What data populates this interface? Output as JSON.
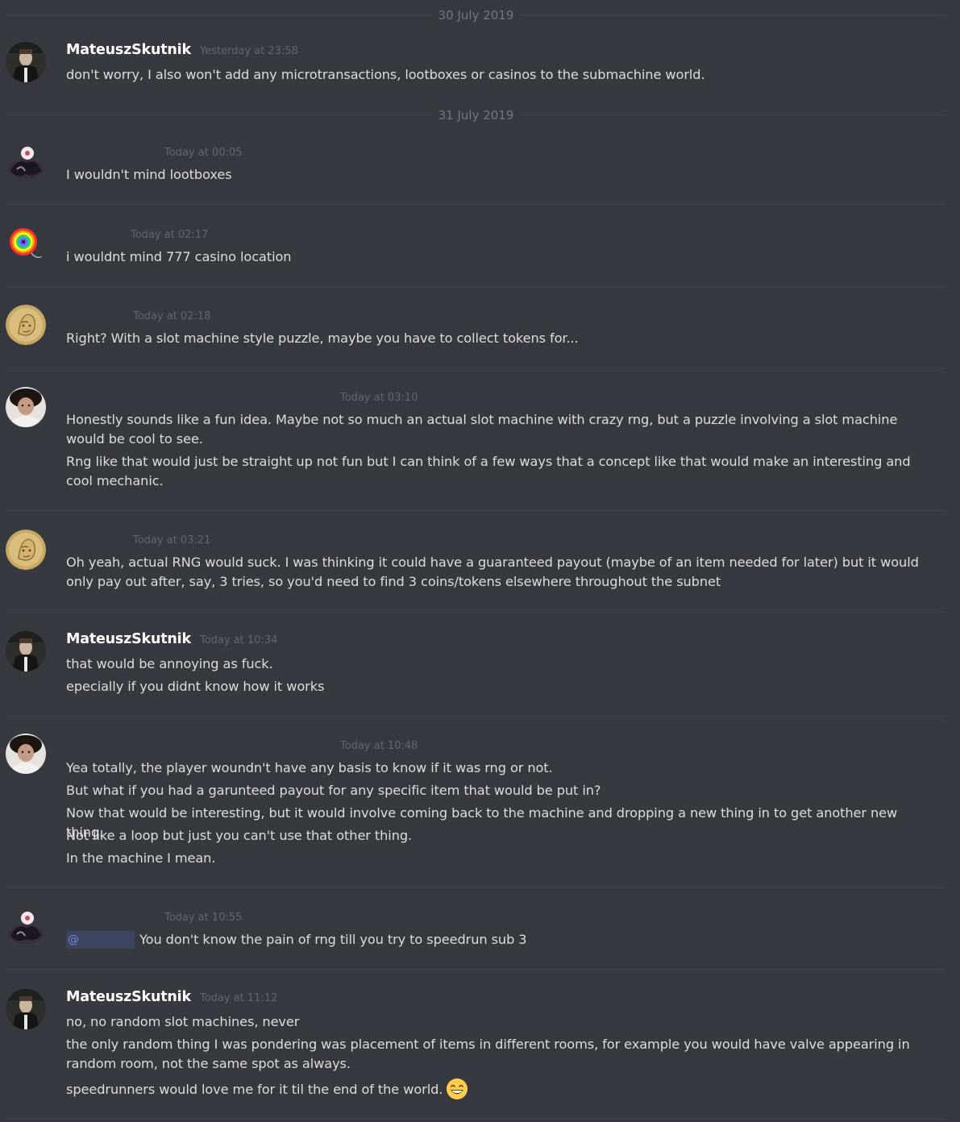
{
  "dividers": [
    "30 July 2019",
    "31 July 2019"
  ],
  "messages": [
    {
      "username": "MateuszSkutnik",
      "timestamp": "Yesterday at 23:58",
      "lines": [
        "don't worry, I also won't add any microtransactions, lootboxes or casinos to the submachine world."
      ]
    },
    {
      "username": "",
      "timestamp": "Today at 00:05",
      "lines": [
        "I wouldn't mind lootboxes"
      ]
    },
    {
      "username": "",
      "timestamp": "Today at 02:17",
      "lines": [
        "i wouldnt mind 777 casino location"
      ]
    },
    {
      "username": "",
      "timestamp": "Today at 02:18",
      "lines": [
        "Right? With a slot machine style puzzle, maybe you have to collect tokens for..."
      ]
    },
    {
      "username": "",
      "timestamp": "Today at 03:10",
      "lines": [
        "Honestly sounds like a fun idea. Maybe not so much an actual slot machine with crazy rng, but a puzzle involving a slot machine would be cool to see.",
        "Rng like that would just be straight up not fun but I can think of a few ways that a concept like that would make an interesting and cool mechanic."
      ]
    },
    {
      "username": "",
      "timestamp": "Today at 03:21",
      "lines": [
        "Oh yeah, actual RNG would suck. I was thinking it could have a guaranteed payout (maybe of an item needed for later) but it would only pay out after, say, 3 tries, so you'd need to find 3 coins/tokens elsewhere throughout the subnet"
      ]
    },
    {
      "username": "MateuszSkutnik",
      "timestamp": "Today at 10:34",
      "lines": [
        "that would be annoying as fuck.",
        "epecially if you didnt know how it works"
      ]
    },
    {
      "username": "",
      "timestamp": "Today at 10:48",
      "lines": [
        "Yea totally, the player woundn't have any basis to know if it was rng or not.",
        "But what if you had a garunteed payout for any specific item that would be put in?",
        "Now that would be interesting, but it would involve coming back to the machine and dropping a new thing in to get another new thing.",
        "Not like a loop but just you can't use that other thing.",
        "In the machine I mean."
      ]
    },
    {
      "username": "",
      "timestamp": "Today at 10:55",
      "mention": "@",
      "lines": [
        "You don't know the pain of rng till you try to speedrun sub 3"
      ]
    },
    {
      "username": "MateuszSkutnik",
      "timestamp": "Today at 11:12",
      "lines": [
        "no, no random slot machines, never",
        "the only random thing I was pondering was placement of items in different rooms, for example you would have valve appearing in random room, not the same spot as always.",
        "speedrunners would love me for it til the end of the world."
      ],
      "emoji": "grinning-smiling-eyes-emoji"
    }
  ],
  "colors": {
    "background": "#36393f",
    "text": "#dcddde",
    "username": "#ffffff",
    "timestamp": "#72767d",
    "mention_bg": "#3e4560",
    "mention_text": "#7289da"
  }
}
